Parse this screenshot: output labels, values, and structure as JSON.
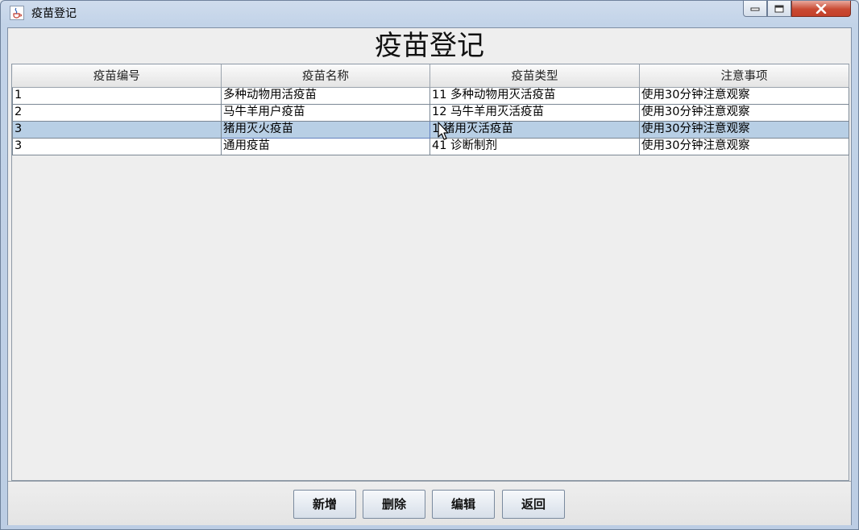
{
  "window": {
    "title": "疫苗登记"
  },
  "heading": "疫苗登记",
  "table": {
    "columns": [
      "疫苗编号",
      "疫苗名称",
      "疫苗类型",
      "注意事项"
    ],
    "rows": [
      [
        "1",
        "多种动物用活疫苗",
        "11  多种动物用灭活疫苗",
        "使用30分钟注意观察"
      ],
      [
        "2",
        "马牛羊用户疫苗",
        "12  马牛羊用灭活疫苗",
        "使用30分钟注意观察"
      ],
      [
        "3",
        "猪用灭火疫苗",
        "1   猪用灭活疫苗",
        "使用30分钟注意观察"
      ],
      [
        "3",
        "通用疫苗",
        "41  诊断制剂",
        "使用30分钟注意观察"
      ]
    ],
    "selected_row": 2
  },
  "buttons": {
    "add": "新增",
    "delete": "删除",
    "edit": "编辑",
    "back": "返回"
  },
  "icons": {
    "app": "java-cup-icon",
    "minimize": "minimize-icon",
    "maximize": "maximize-icon",
    "close": "close-icon",
    "cursor": "mouse-pointer-icon"
  }
}
